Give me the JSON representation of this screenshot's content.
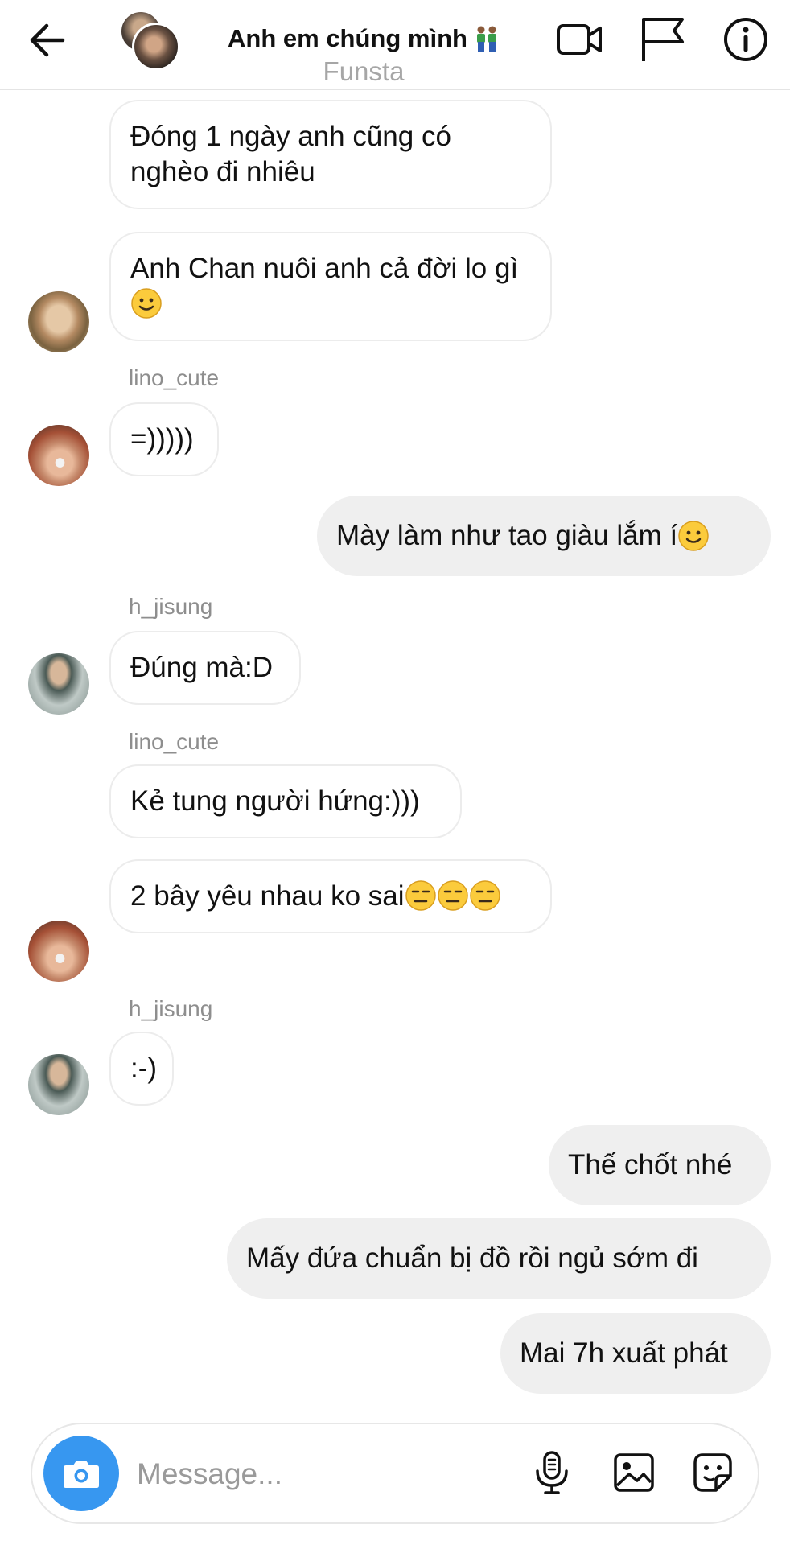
{
  "header": {
    "back_icon": "arrow-left-icon",
    "title": "Anh em chúng mình",
    "subtitle": "Funsta",
    "icons": [
      "video-call-icon",
      "flag-icon",
      "info-icon"
    ]
  },
  "messages": [
    {
      "type": "in",
      "text": "Đóng 1 ngày anh cũng có nghèo đi nhiêu"
    },
    {
      "type": "in",
      "text": "Anh Chan nuôi anh cả đời lo gì"
    },
    {
      "type": "sender",
      "text": "lino_cute"
    },
    {
      "type": "in",
      "text": "=)))))"
    },
    {
      "type": "out",
      "text": "Mày làm như tao giàu lắm í"
    },
    {
      "type": "sender",
      "text": "h_jisung"
    },
    {
      "type": "in",
      "text": "Đúng mà:D"
    },
    {
      "type": "sender",
      "text": "lino_cute"
    },
    {
      "type": "in",
      "text": "Kẻ tung người hứng:)))"
    },
    {
      "type": "in",
      "text": "2 bây yêu nhau ko sai"
    },
    {
      "type": "sender",
      "text": "h_jisung"
    },
    {
      "type": "in",
      "text": ":-)"
    },
    {
      "type": "out",
      "text": "Thế chốt nhé"
    },
    {
      "type": "out",
      "text": "Mấy đứa chuẩn bị đồ rồi ngủ sớm đi"
    },
    {
      "type": "out",
      "text": "Mai 7h xuất phát"
    }
  ],
  "composer": {
    "placeholder": "Message...",
    "icons": [
      "camera-icon",
      "microphone-icon",
      "gallery-icon",
      "sticker-icon"
    ],
    "accent": "#3797f0"
  },
  "colors": {
    "outgoing_bubble": "#efefef",
    "incoming_border": "#ececec",
    "sender_name": "#8e8e8e"
  }
}
